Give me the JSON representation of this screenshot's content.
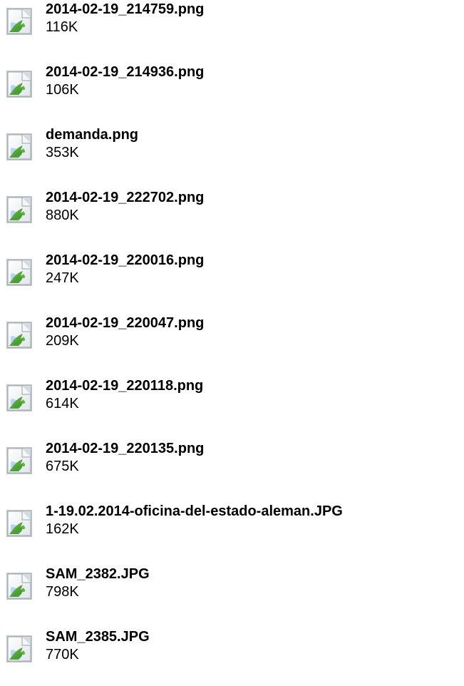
{
  "files": [
    {
      "name": "2014-02-19_214759.png",
      "size": "116K",
      "icon": "image-file-icon"
    },
    {
      "name": "2014-02-19_214936.png",
      "size": "106K",
      "icon": "image-file-icon"
    },
    {
      "name": "demanda.png",
      "size": "353K",
      "icon": "image-file-icon"
    },
    {
      "name": "2014-02-19_222702.png",
      "size": "880K",
      "icon": "image-file-icon"
    },
    {
      "name": "2014-02-19_220016.png",
      "size": "247K",
      "icon": "image-file-icon"
    },
    {
      "name": "2014-02-19_220047.png",
      "size": "209K",
      "icon": "image-file-icon"
    },
    {
      "name": "2014-02-19_220118.png",
      "size": "614K",
      "icon": "image-file-icon"
    },
    {
      "name": "2014-02-19_220135.png",
      "size": "675K",
      "icon": "image-file-icon"
    },
    {
      "name": "1-19.02.2014-oficina-del-estado-aleman.JPG",
      "size": "162K",
      "icon": "image-file-icon"
    },
    {
      "name": "SAM_2382.JPG",
      "size": "798K",
      "icon": "image-file-icon"
    },
    {
      "name": "SAM_2385.JPG",
      "size": "770K",
      "icon": "image-file-icon"
    }
  ]
}
